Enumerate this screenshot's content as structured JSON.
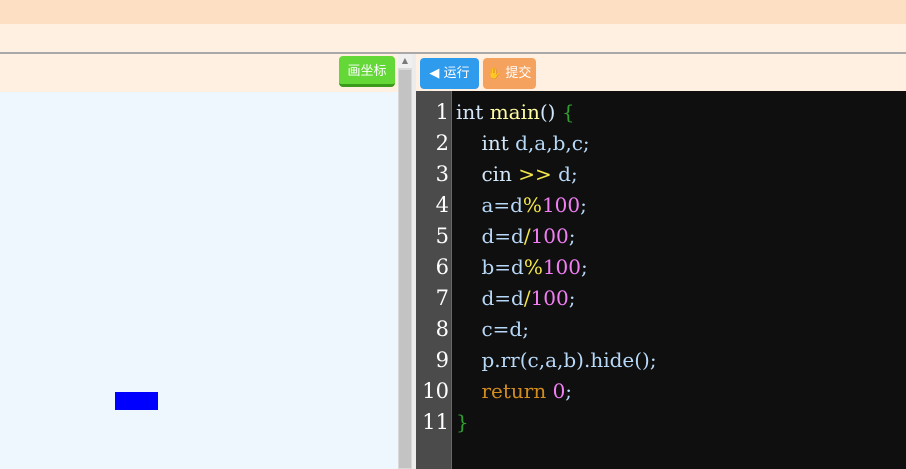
{
  "left_panel": {
    "draw_button_label": "画坐标"
  },
  "right_toolbar": {
    "run_button_label": "运行",
    "run_icon": "arrow-left-icon",
    "submit_button_label": "提交",
    "submit_icon": "hand-icon"
  },
  "editor": {
    "line_numbers": [
      "1",
      "2",
      "3",
      "4",
      "5",
      "6",
      "7",
      "8",
      "9",
      "10",
      "11"
    ],
    "lines": [
      [
        [
          "int",
          "kw"
        ],
        [
          " ",
          ""
        ],
        [
          "main",
          "fn"
        ],
        [
          "()",
          "kw"
        ],
        [
          " ",
          ""
        ],
        [
          "{",
          "green"
        ]
      ],
      [
        [
          "    ",
          ""
        ],
        [
          "int",
          "kw"
        ],
        [
          " d,a,b,c;",
          ""
        ]
      ],
      [
        [
          "    ",
          ""
        ],
        [
          "cin",
          "kw"
        ],
        [
          " ",
          ""
        ],
        [
          ">>",
          "op"
        ],
        [
          " d;",
          ""
        ]
      ],
      [
        [
          "    ",
          ""
        ],
        [
          "a=d",
          ""
        ],
        [
          "%",
          "op"
        ],
        [
          "100",
          "num"
        ],
        [
          ";",
          ""
        ]
      ],
      [
        [
          "    ",
          ""
        ],
        [
          "d=d",
          ""
        ],
        [
          "/",
          "op"
        ],
        [
          "100",
          "num"
        ],
        [
          ";",
          ""
        ]
      ],
      [
        [
          "    ",
          ""
        ],
        [
          "b=d",
          ""
        ],
        [
          "%",
          "op"
        ],
        [
          "100",
          "num"
        ],
        [
          ";",
          ""
        ]
      ],
      [
        [
          "    ",
          ""
        ],
        [
          "d=d",
          ""
        ],
        [
          "/",
          "op"
        ],
        [
          "100",
          "num"
        ],
        [
          ";",
          ""
        ]
      ],
      [
        [
          "    ",
          ""
        ],
        [
          "c=d;",
          ""
        ]
      ],
      [
        [
          "    ",
          ""
        ],
        [
          "p.rr(c,a,b).hide();",
          ""
        ]
      ],
      [
        [
          "    ",
          ""
        ],
        [
          "return",
          "ret"
        ],
        [
          " ",
          ""
        ],
        [
          "0",
          "num"
        ],
        [
          ";",
          ""
        ]
      ],
      [
        [
          "}",
          "green"
        ]
      ]
    ]
  },
  "colors": {
    "topbar": "#fde0c3",
    "toolbar": "#fff0e2",
    "canvas": "#eef6fe",
    "draw_button": "#63d837",
    "run_button": "#2f9bec",
    "submit_button": "#f5a25f",
    "editor_bg": "#0f0f0f",
    "shape_fill": "#0000ff"
  }
}
